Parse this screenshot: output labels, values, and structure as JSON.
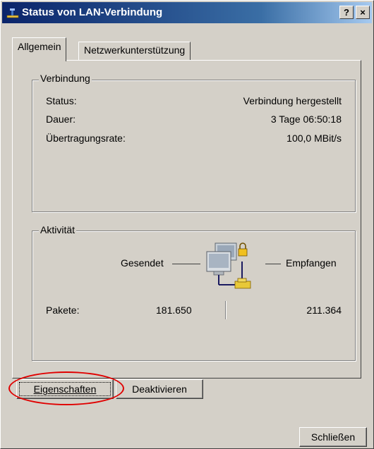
{
  "window": {
    "title": "Status von LAN-Verbindung",
    "help_label": "?",
    "close_label": "×"
  },
  "tabs": [
    {
      "label": "Allgemein",
      "active": true
    },
    {
      "label": "Netzwerkunterstützung",
      "active": false
    }
  ],
  "connection": {
    "legend": "Verbindung",
    "rows": [
      {
        "label": "Status:",
        "value": "Verbindung hergestellt"
      },
      {
        "label": "Dauer:",
        "value": "3 Tage 06:50:18"
      },
      {
        "label": "Übertragungsrate:",
        "value": "100,0 MBit/s"
      }
    ]
  },
  "activity": {
    "legend": "Aktivität",
    "sent_label": "Gesendet",
    "received_label": "Empfangen",
    "packets_label": "Pakete:",
    "packets_sent": "181.650",
    "packets_received": "211.364"
  },
  "buttons": {
    "properties": "Eigenschaften",
    "deactivate": "Deaktivieren",
    "close": "Schließen"
  },
  "icons": {
    "title": "network-connection-icon",
    "activity": "network-computers-icon",
    "lock": "lock-icon"
  },
  "colors": {
    "highlight_ellipse": "#e00000",
    "title_bar": "#0a246a"
  }
}
